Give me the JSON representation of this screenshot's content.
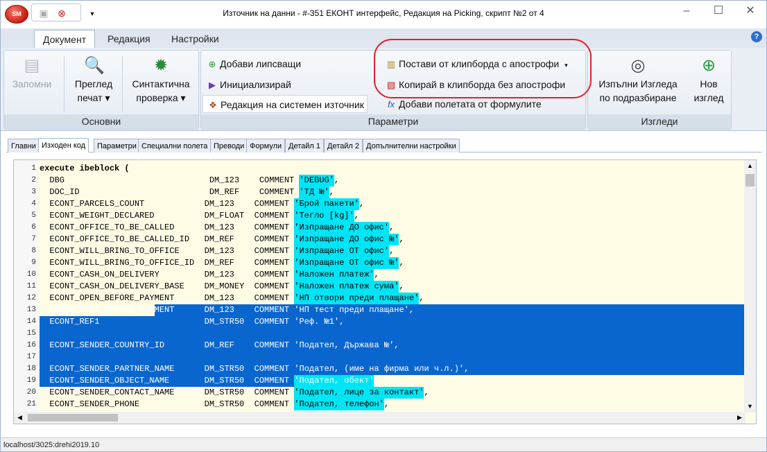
{
  "window": {
    "title": "Източник на данни - #-351 ЕКОНТ интерфейс, Редакция на Picking, скрипт №2 от 4",
    "logo_text": "SM"
  },
  "ribbon_tabs": [
    "Документ",
    "Редакция",
    "Настройки"
  ],
  "groups": {
    "basic": {
      "label": "Основни",
      "save": "Запомни",
      "preview": [
        "Преглед",
        "печат ▾"
      ],
      "syntax": [
        "Синтактична",
        "проверка ▾"
      ]
    },
    "params": {
      "label": "Параметри",
      "add_missing": "Добави липсващи",
      "initialize": "Инициализирай",
      "edit_system_source": "Редакция на системен източник",
      "paste_apostrophes": "Постави от клипборда с апострофи",
      "copy_no_apostrophes": "Копирай в клипборда без апострофи",
      "add_formula_fields": "Добави полетата от формулите"
    },
    "views": {
      "label": "Изгледи",
      "run_default": [
        "Изпълни Изгледа",
        "по подразбиране"
      ],
      "new_view": [
        "Нов",
        "изглед"
      ]
    }
  },
  "content_tabs": [
    "Главни",
    "Изходен код",
    "Параметри",
    "Специални полета",
    "Преводи",
    "Формули",
    "Детайл 1",
    "Детайл 2",
    "Допълнителни настройки"
  ],
  "code_lines": [
    {
      "n": "1",
      "text": "execute ibeblock ("
    },
    {
      "n": "2",
      "text": "  DBG                             DM_123    COMMENT 'DEBUG',"
    },
    {
      "n": "3",
      "text": "  DOC_ID                          DM_REF    COMMENT 'ТД №',"
    },
    {
      "n": "4",
      "text": "  ECONT_PARCELS_COUNT            DM_123    COMMENT 'Брой пакети',"
    },
    {
      "n": "5",
      "text": "  ECONT_WEIGHT_DECLARED          DM_FLOAT  COMMENT 'Тегло [kg]',"
    },
    {
      "n": "6",
      "text": "  ECONT_OFFICE_TO_BE_CALLED      DM_123    COMMENT 'Изпращане ДО офис',"
    },
    {
      "n": "7",
      "text": "  ECONT_OFFICE_TO_BE_CALLED_ID   DM_REF    COMMENT 'Изпращане ДО офис №',"
    },
    {
      "n": "8",
      "text": "  ECONT_WILL_BRING_TO_OFFICE     DM_123    COMMENT 'Изпращане ОТ офис',"
    },
    {
      "n": "9",
      "text": "  ECONT_WILL_BRING_TO_OFFICE_ID  DM_REF    COMMENT 'Изпращане ОТ офис №',"
    },
    {
      "n": "10",
      "text": "  ECONT_CASH_ON_DELIVERY         DM_123    COMMENT 'Наложен платеж',"
    },
    {
      "n": "11",
      "text": "  ECONT_CASH_ON_DELIVERY_BASE    DM_MONEY  COMMENT 'Наложен платеж сума',"
    },
    {
      "n": "12",
      "text": "  ECONT_OPEN_BEFORE_PAYMENT      DM_123    COMMENT 'НП отвори преди плащане',"
    },
    {
      "n": "13",
      "text": "  ECONT_TEST_BEFORE_PAYMENT      DM_123    COMMENT 'НП тест преди плащане',"
    },
    {
      "n": "14",
      "text": "  ECONT_REF1                     DM_STR50  COMMENT 'Реф. №1',"
    },
    {
      "n": "15",
      "text": ""
    },
    {
      "n": "16",
      "text": "  ECONT_SENDER_COUNTRY_ID        DM_REF    COMMENT 'Подател, Държава №',"
    },
    {
      "n": "17",
      "text": ""
    },
    {
      "n": "18",
      "text": "  ECONT_SENDER_PARTNER_NAME      DM_STR50  COMMENT 'Подател, (име на фирма или ч.л.)',"
    },
    {
      "n": "19",
      "text": "  ECONT_SENDER_OBJECT_NAME       DM_STR50  COMMENT 'Подател, обект',"
    },
    {
      "n": "20",
      "text": "  ECONT_SENDER_CONTACT_NAME      DM_STR50  COMMENT 'Подател, лице за контакт',"
    },
    {
      "n": "21",
      "text": "  ECONT_SENDER_PHONE             DM_STR50  COMMENT 'Подател, телефон',"
    }
  ],
  "status_text": "localhost/3025:drehi2019.10",
  "colors": {
    "selection": "#0a66cf",
    "string_highlight": "#00e5f5",
    "annotation": "#e0202a"
  }
}
